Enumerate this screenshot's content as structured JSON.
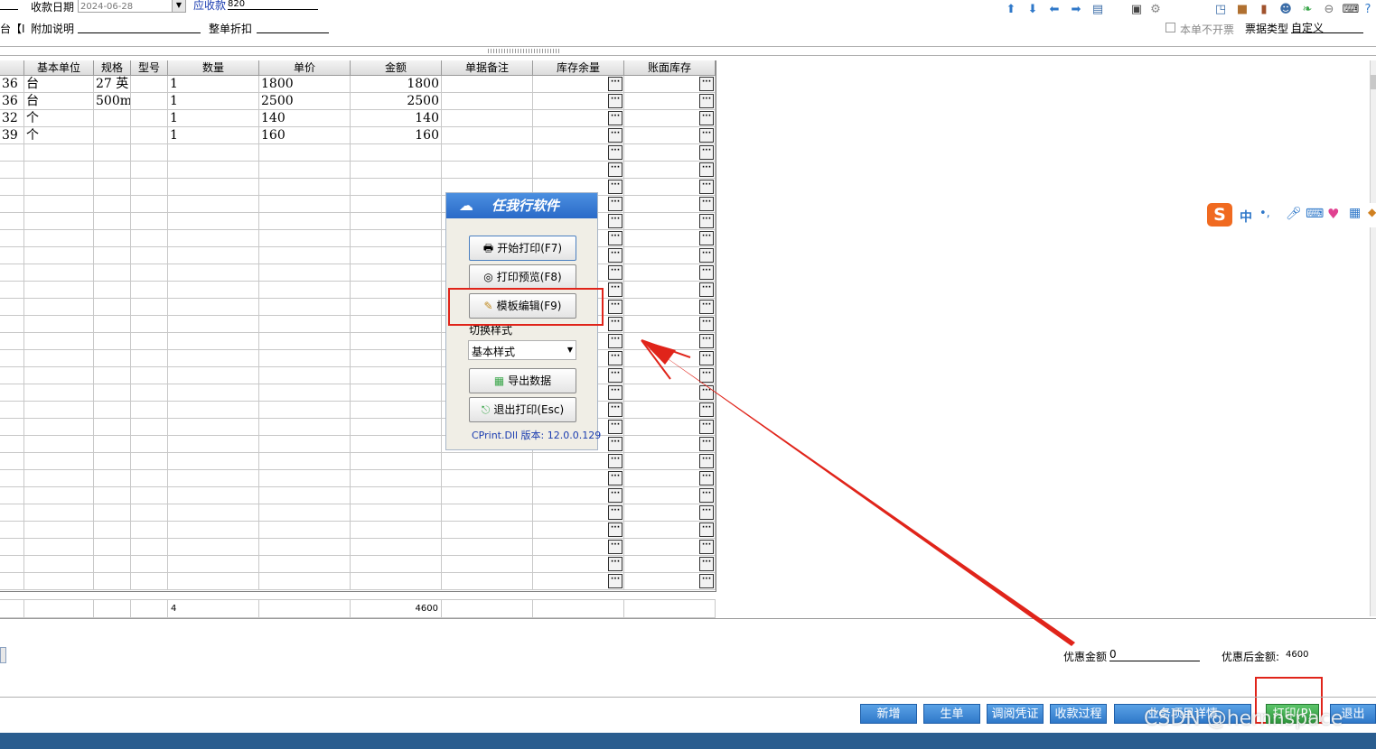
{
  "header": {
    "date_label": "收款日期",
    "date_value": "2024-06-28",
    "receivable_label": "应收款",
    "receivable_value": "820",
    "left_cut": "台【I",
    "note_label": "附加说明",
    "discount_label": "整单折扣",
    "no_invoice_label": "本单不开票",
    "bill_type_label": "票据类型",
    "bill_type_value": "自定义"
  },
  "grid": {
    "columns": [
      "基本单位",
      "规格",
      "型号",
      "数量",
      "单价",
      "金额",
      "单据备注",
      "库存余量",
      "账面库存"
    ],
    "rows": [
      {
        "id": "36",
        "unit": "台",
        "spec": "27 英",
        "model": "",
        "qty": "1",
        "price": "1800",
        "amount": "1800"
      },
      {
        "id": "36",
        "unit": "台",
        "spec": "500mm",
        "model": "",
        "qty": "1",
        "price": "2500",
        "amount": "2500"
      },
      {
        "id": "32",
        "unit": "个",
        "spec": "",
        "model": "",
        "qty": "1",
        "price": "140",
        "amount": "140"
      },
      {
        "id": "39",
        "unit": "个",
        "spec": "",
        "model": "",
        "qty": "1",
        "price": "160",
        "amount": "160"
      }
    ],
    "totals": {
      "qty": "4",
      "amount": "4600"
    },
    "ellipsis": "···"
  },
  "dialog": {
    "title": "任我行软件",
    "start_print": "开始打印(F7)",
    "print_preview": "打印预览(F8)",
    "template_edit": "模板编辑(F9)",
    "switch_style_label": "切换样式",
    "style_value": "基本样式",
    "export_data": "导出数据",
    "exit_print": "退出打印(Esc)",
    "version": "CPrint.Dll 版本: 12.0.0.129"
  },
  "ime": {
    "logo": "S",
    "mode": "中",
    "punct": "•,"
  },
  "footer": {
    "discount_amount_label": "优惠金额",
    "discount_amount_value": "0",
    "after_discount_label": "优惠后金额:",
    "after_discount_value": "4600",
    "buttons": [
      "新增",
      "生单",
      "调阅凭证",
      "收款过程",
      "业务项目详情",
      "打印(P)",
      "退出"
    ],
    "watermark": "CSDN @hernnspace"
  },
  "colors": {
    "accent": "#2f78c9",
    "highlight": "#e0241a",
    "print_btn": "#3aa64a",
    "statusbar": "#2a5d8f"
  }
}
